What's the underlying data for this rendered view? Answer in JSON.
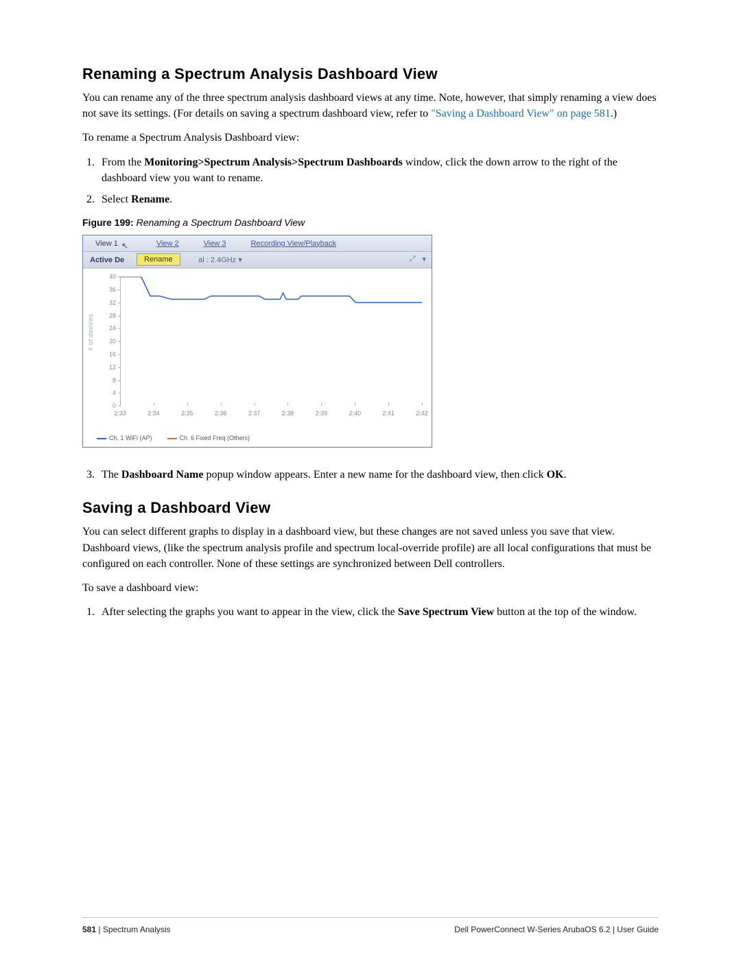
{
  "section1": {
    "heading": "Renaming a Spectrum Analysis Dashboard View",
    "para1_a": "You can rename any of the three spectrum analysis dashboard views at any time. Note, however, that simply renaming a view does not save its settings. (For details on saving a spectrum dashboard view, refer to ",
    "link1": "\"Saving a Dashboard View\" on page 581",
    "para1_b": ".)",
    "para2": "To rename a Spectrum Analysis Dashboard view:",
    "step1_a": "From the ",
    "step1_bold": "Monitoring>Spectrum Analysis>Spectrum Dashboards",
    "step1_b": " window, click the down arrow to the right of the dashboard view you want to rename.",
    "step2_a": "Select ",
    "step2_bold": "Rename",
    "step2_b": ".",
    "fig_label": "Figure 199:",
    "fig_title": " Renaming a Spectrum Dashboard View",
    "step3_a": "The ",
    "step3_bold1": "Dashboard Name",
    "step3_b": " popup window appears. Enter a new name for the dashboard view, then click ",
    "step3_bold2": "OK",
    "step3_c": "."
  },
  "figure": {
    "tabs": {
      "t1": "View 1",
      "t2": "View 2",
      "t3": "View 3",
      "t4": "Recording View/Playback"
    },
    "subbar_label": "Active De",
    "rename_label": "Rename",
    "subbar_rest": "al : 2.4GHz  ▾",
    "icon_expand": "⤢",
    "icon_menu": "▾",
    "yaxis_label": "# of devices",
    "legend1": "Ch. 1 WiFi (AP)",
    "legend2": "Ch. 6 Fixed Freq (Others)"
  },
  "section2": {
    "heading": "Saving a Dashboard View",
    "para1": "You can select different graphs to display in a dashboard view, but these changes are not saved unless you save that view. Dashboard views, (like the spectrum analysis profile and spectrum local-override profile) are all local configurations that must be configured on each controller. None of these settings are synchronized between Dell controllers.",
    "para2": "To save a dashboard view:",
    "step1_a": "After selecting the graphs you want to appear in the view, click the ",
    "step1_bold": "Save Spectrum View",
    "step1_b": " button at the top of the window."
  },
  "footer": {
    "page_num": "581",
    "left_sep": " | ",
    "left_text": "Spectrum Analysis",
    "right": "Dell PowerConnect W-Series ArubaOS 6.2  |  User Guide"
  },
  "chart_data": {
    "type": "line",
    "xlabel": "",
    "ylabel": "# of devices",
    "ylim": [
      0,
      40
    ],
    "x_categories": [
      "2:33",
      "2:34",
      "2:35",
      "2:36",
      "2:37",
      "2:38",
      "2:39",
      "2:40",
      "2:41",
      "2:42"
    ],
    "y_ticks": [
      0,
      4,
      8,
      12,
      16,
      20,
      24,
      28,
      32,
      36,
      40
    ],
    "series": [
      {
        "name": "Ch. 1 WiFi (AP)",
        "color": "#2a5fd6",
        "points": [
          [
            0.0,
            40
          ],
          [
            0.07,
            40
          ],
          [
            0.1,
            34
          ],
          [
            0.13,
            34
          ],
          [
            0.17,
            33
          ],
          [
            0.28,
            33
          ],
          [
            0.3,
            34
          ],
          [
            0.46,
            34
          ],
          [
            0.48,
            33
          ],
          [
            0.53,
            33
          ],
          [
            0.54,
            35
          ],
          [
            0.55,
            33
          ],
          [
            0.59,
            33
          ],
          [
            0.6,
            34
          ],
          [
            0.76,
            34
          ],
          [
            0.78,
            32
          ],
          [
            1.0,
            32
          ]
        ]
      }
    ],
    "legend_entries": [
      "Ch. 1 WiFi (AP)",
      "Ch. 6 Fixed Freq (Others)"
    ]
  }
}
